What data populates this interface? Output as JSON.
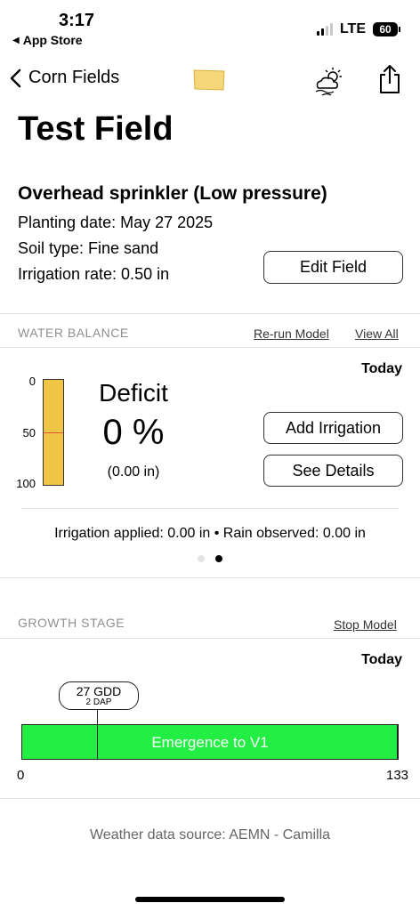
{
  "status_bar": {
    "time": "3:17",
    "back_app": "App Store",
    "network": "LTE",
    "battery": "60"
  },
  "nav": {
    "back_label": "Corn Fields"
  },
  "field": {
    "title": "Test Field",
    "irrigation_type": "Overhead sprinkler (Low pressure)",
    "planting_date": "Planting date: May 27 2025",
    "soil_type": "Soil type: Fine sand",
    "irrigation_rate": "Irrigation rate: 0.50 in",
    "edit_button": "Edit Field"
  },
  "water_balance": {
    "section_label": "WATER BALANCE",
    "rerun_link": "Re-run Model",
    "view_all_link": "View All",
    "today_label": "Today",
    "gauge_labels": [
      "0",
      "50",
      "100"
    ],
    "gauge_fill_percent": 100,
    "status_label": "Deficit",
    "percent": "0 %",
    "amount": "(0.00 in)",
    "add_irrigation_button": "Add Irrigation",
    "see_details_button": "See Details",
    "summary": "Irrigation applied: 0.00 in • Rain observed: 0.00 in",
    "page_count": 2,
    "active_page": 2
  },
  "growth_stage": {
    "section_label": "GROWTH STAGE",
    "stop_model_link": "Stop Model",
    "today_label": "Today",
    "gdd": "27 GDD",
    "dap": "2 DAP",
    "stage_label": "Emergence to V1",
    "range_start": "0",
    "range_end": "133"
  },
  "footer": {
    "weather_source": "Weather data source: AEMN - Camilla"
  },
  "colors": {
    "gauge_fill": "#f0c545",
    "growth_bar": "#22ee44",
    "field_shape": "#f5d77a"
  }
}
